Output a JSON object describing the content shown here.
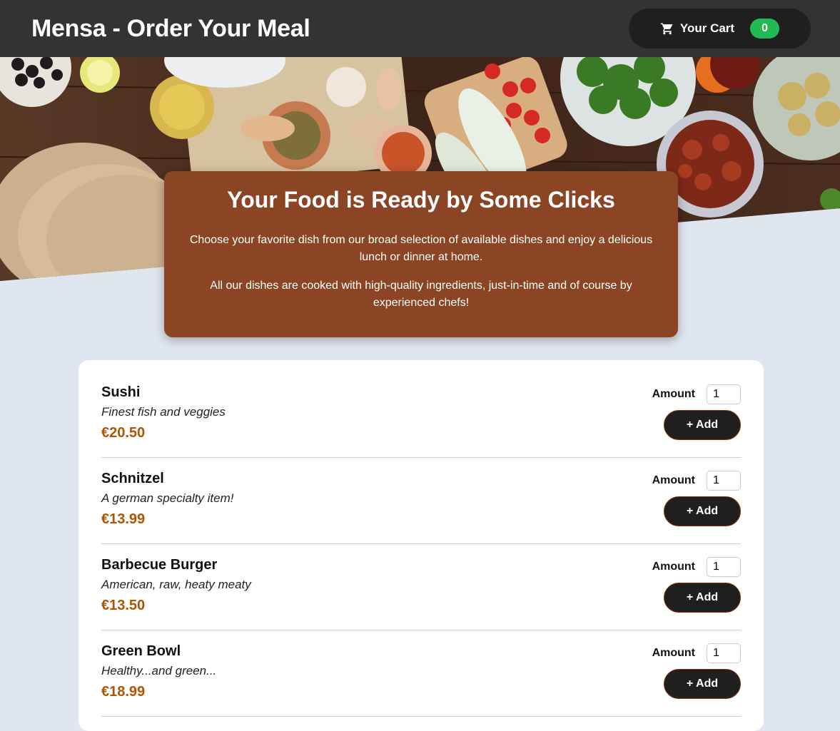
{
  "header": {
    "title": "Mensa - Order Your Meal",
    "cart_label": "Your Cart",
    "cart_count": "0"
  },
  "hero": {
    "image": "food-table-photo"
  },
  "summary": {
    "title": "Your Food is Ready by Some Clicks",
    "paragraph1": "Choose your favorite dish from our broad selection of available dishes and enjoy a delicious lunch or dinner at home.",
    "paragraph2": "All our dishes are cooked with high-quality ingredients, just-in-time and of course by experienced chefs!"
  },
  "meals": [
    {
      "name": "Sushi",
      "description": "Finest fish and veggies",
      "price": "€20.50",
      "amount_label": "Amount",
      "amount": "1",
      "add_label": "+ Add"
    },
    {
      "name": "Schnitzel",
      "description": "A german specialty item!",
      "price": "€13.99",
      "amount_label": "Amount",
      "amount": "1",
      "add_label": "+ Add"
    },
    {
      "name": "Barbecue Burger",
      "description": "American, raw, heaty meaty",
      "price": "€13.50",
      "amount_label": "Amount",
      "amount": "1",
      "add_label": "+ Add"
    },
    {
      "name": "Green Bowl",
      "description": "Healthy...and green...",
      "price": "€18.99",
      "amount_label": "Amount",
      "amount": "1",
      "add_label": "+ Add"
    }
  ],
  "colors": {
    "header_bg": "#333333",
    "summary_bg": "#8b4424",
    "price": "#ad5502",
    "badge": "#23b953"
  }
}
